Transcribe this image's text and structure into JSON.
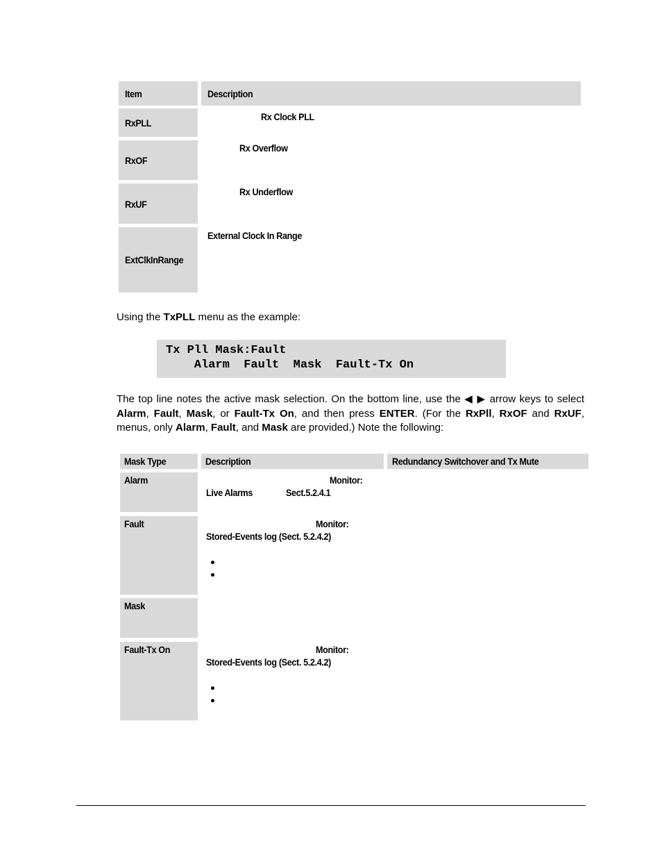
{
  "table1": {
    "headers": {
      "item": "Item",
      "description": "Description"
    },
    "rows": [
      {
        "item": "RxPLL",
        "description": "Rx  Clock  PLL"
      },
      {
        "item": "RxOF",
        "description": "Rx Overflow"
      },
      {
        "item": "RxUF",
        "description": "Rx Underflow"
      },
      {
        "item": "ExtClkInRange",
        "description": "External Clock In Range"
      }
    ]
  },
  "intro": {
    "prefix": "Using the ",
    "menu": "TxPLL",
    "suffix": " menu as the example:"
  },
  "lcd": {
    "line1": "Tx Pll Mask:Fault",
    "line2": "    Alarm  Fault  Mask  Fault-Tx On"
  },
  "paragraph": {
    "t1": "The top line notes the active mask selection. On the bottom line, use the ",
    "left_arrow": "◀",
    "right_arrow": "▶",
    "t2": " arrow keys to select ",
    "alarm": "Alarm",
    "comma1": ", ",
    "fault": "Fault",
    "comma2": ", ",
    "mask": "Mask",
    "t3": ", or ",
    "fault_tx_on": "Fault-Tx On",
    "t4": ", and then press ",
    "enter": "ENTER",
    "t5": ". (For the ",
    "rxpll": "RxPll",
    "comma3": ", ",
    "rxof": "RxOF",
    "t6": " and ",
    "rxuf": "RxUF",
    "t7": ", menus, only ",
    "alarm2": "Alarm",
    "comma4": ", ",
    "fault2": "Fault",
    "t8": ", and ",
    "mask2": "Mask",
    "t9": " are provided.) Note the following:"
  },
  "table2": {
    "headers": {
      "mask_type": "Mask Type",
      "description": "Description",
      "redundancy": "Redundancy Switchover and Tx Mute"
    },
    "rows": [
      {
        "mask_type": "Alarm",
        "monitor": "Monitor:",
        "ref_a": "Live Alarms",
        "ref_b": "Sect.5.2.4.1"
      },
      {
        "mask_type": "Fault",
        "monitor": "Monitor:",
        "ref": "Stored-Events log (Sect. 5.2.4.2)",
        "bullets": 2
      },
      {
        "mask_type": "Mask"
      },
      {
        "mask_type": "Fault-Tx On",
        "monitor": "Monitor:",
        "ref": "Stored-Events log (Sect. 5.2.4.2)",
        "bullets": 2
      }
    ]
  }
}
